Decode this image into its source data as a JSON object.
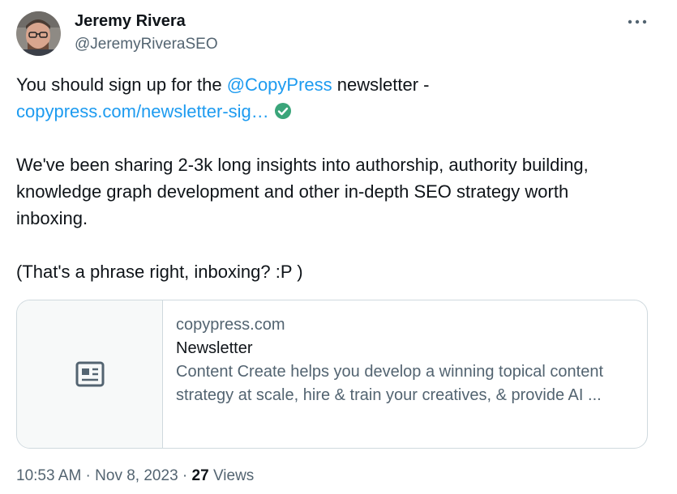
{
  "author": {
    "name": "Jeremy Rivera",
    "handle": "@JeremyRiveraSEO"
  },
  "icons": {
    "more": "more-horizontal-icon",
    "verified": "verified-check-icon",
    "article": "article-icon"
  },
  "tweet": {
    "line1_prefix": "You should sign up for the ",
    "mention": "@CopyPress",
    "line1_suffix": " newsletter -",
    "url": "copypress.com/newsletter-sig…",
    "paragraph2_line1": "We've been sharing 2-3k long insights into authorship, authority building,",
    "paragraph2_line2": "knowledge graph development and other in-depth SEO strategy worth",
    "paragraph2_line3": "inboxing.",
    "paragraph3": "(That's a phrase right, inboxing? :P )"
  },
  "card": {
    "domain": "copypress.com",
    "title": "Newsletter",
    "description_line1": "Content Create helps you develop a winning topical content",
    "description_line2": "strategy at scale, hire & train your creatives, & provide AI ..."
  },
  "meta": {
    "time": "10:53 AM",
    "separator1": " · ",
    "date": "Nov 8, 2023",
    "separator2": " · ",
    "views_count": "27",
    "views_label": " Views"
  },
  "colors": {
    "link": "#1d9bf0",
    "verified": "#3aa57a",
    "muted": "#536471",
    "text": "#0f1419",
    "border": "#cfd9de"
  }
}
